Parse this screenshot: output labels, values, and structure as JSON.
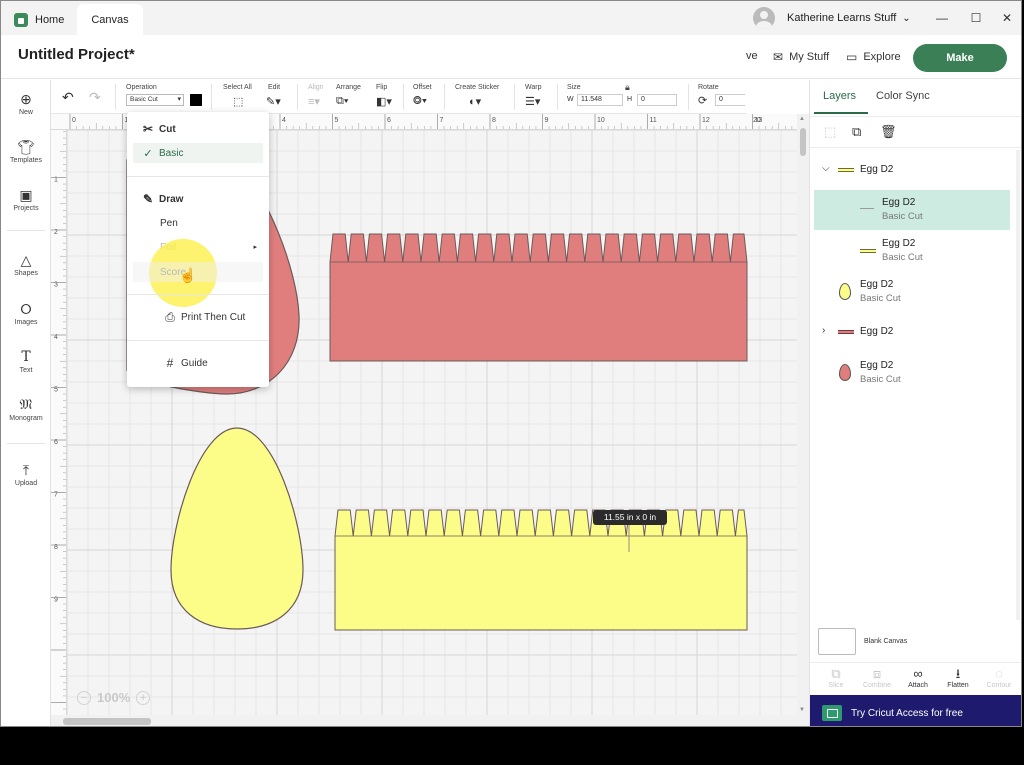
{
  "tabs": {
    "home": "Home",
    "canvas": "Canvas"
  },
  "user": {
    "name": "Katherine Learns Stuff"
  },
  "window": {
    "minimize": "—",
    "maximize": "☐",
    "close": "✕"
  },
  "header": {
    "title": "Untitled Project*",
    "save_partial": "ve",
    "my_stuff": "My Stuff",
    "explore": "Explore",
    "make": "Make"
  },
  "sidebar": {
    "items": [
      {
        "label": "New",
        "icon": "plus-circle-icon"
      },
      {
        "label": "Templates",
        "icon": "shirt-icon"
      },
      {
        "label": "Projects",
        "icon": "projects-icon"
      },
      {
        "label": "Shapes",
        "icon": "shapes-icon"
      },
      {
        "label": "Images",
        "icon": "lightbulb-icon"
      },
      {
        "label": "Text",
        "icon": "text-icon"
      },
      {
        "label": "Monogram",
        "icon": "monogram-icon"
      },
      {
        "label": "Upload",
        "icon": "upload-icon"
      }
    ]
  },
  "toolbar": {
    "operation_label": "Operation",
    "operation_value": "Basic Cut",
    "operation_color": "#000000",
    "select_all": "Select All",
    "edit": "Edit",
    "align": "Align",
    "arrange": "Arrange",
    "flip": "Flip",
    "offset": "Offset",
    "create_sticker": "Create Sticker",
    "warp": "Warp",
    "size": "Size",
    "w_label": "W",
    "w_value": "11.548",
    "h_label": "H",
    "h_value": "0",
    "rotate": "Rotate",
    "rotate_value": "0"
  },
  "ruler": {
    "top": [
      "0",
      "1",
      "2",
      "3",
      "4",
      "5",
      "6",
      "7",
      "8",
      "9",
      "10",
      "11",
      "12",
      "13",
      "20"
    ],
    "left": [
      "1",
      "2",
      "3",
      "4",
      "5",
      "6",
      "7",
      "8",
      "9"
    ]
  },
  "operation_menu": {
    "cut_header": "Cut",
    "basic": "Basic",
    "draw_header": "Draw",
    "pen": "Pen",
    "foil": "Foil",
    "score": "Score",
    "print_then_cut": "Print Then Cut",
    "guide": "Guide"
  },
  "canvas": {
    "zoom": "100%",
    "dimension_tip": "11.55  in x 0  in",
    "colors": {
      "pink": "#e07e7e",
      "yellow": "#fbfd88",
      "outline": "#6b5a5a"
    }
  },
  "panel": {
    "tab_layers": "Layers",
    "tab_color_sync": "Color Sync",
    "layers": [
      {
        "name": "Egg D2",
        "sub": "",
        "swatch": "line-yellow",
        "group": true,
        "expanded": true
      },
      {
        "name": "Egg D2",
        "sub": "Basic Cut",
        "swatch": "line-gray",
        "selected": true
      },
      {
        "name": "Egg D2",
        "sub": "Basic Cut",
        "swatch": "line-yellow"
      },
      {
        "name": "Egg D2",
        "sub": "Basic Cut",
        "swatch": "egg-yellow"
      },
      {
        "name": "Egg D2",
        "sub": "",
        "swatch": "line-pink",
        "group": true,
        "expanded": false
      },
      {
        "name": "Egg D2",
        "sub": "Basic Cut",
        "swatch": "egg-pink"
      }
    ],
    "blank_canvas": "Blank Canvas",
    "actions": [
      "Slice",
      "Combine",
      "Attach",
      "Flatten",
      "Contour"
    ],
    "access_banner": "Try Cricut Access for free"
  }
}
